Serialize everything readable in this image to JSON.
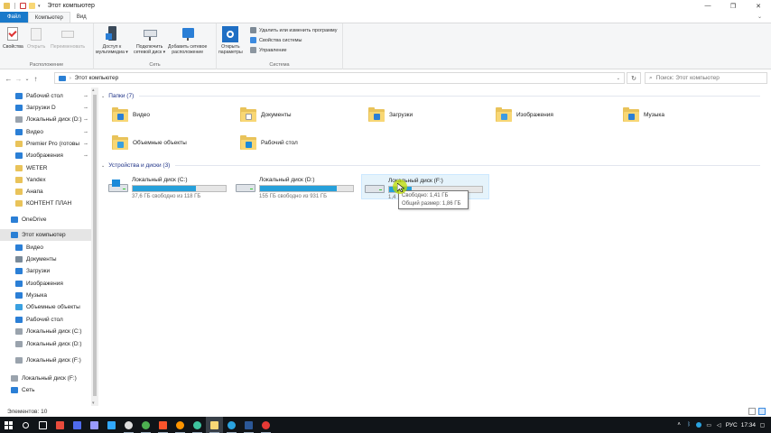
{
  "window": {
    "title": "Этот компьютер",
    "minimize": "—",
    "maximize": "❐",
    "close": "✕"
  },
  "ribbon_tabs": {
    "file": "Файл",
    "computer": "Компьютер",
    "view": "Вид",
    "collapse": "⌄"
  },
  "ribbon": {
    "groups": {
      "location": "Расположение",
      "network": "Сеть",
      "system": "Система"
    },
    "properties": "Свойства",
    "open": "Открыть",
    "rename": "Переименовать",
    "media_access_1": "Доступ к",
    "media_access_2": "мультимедиа ▾",
    "map_drive_1": "Подключить",
    "map_drive_2": "сетевой диск ▾",
    "add_location_1": "Добавить сетевое",
    "add_location_2": "расположение",
    "open_settings_1": "Открыть",
    "open_settings_2": "параметры",
    "uninstall": "Удалить или изменить программу",
    "system_props": "Свойства системы",
    "manage": "Управление"
  },
  "address": {
    "back": "←",
    "forward": "→",
    "recent": "⌄",
    "up": "↑",
    "path": "Этот компьютер",
    "dropdown": "⌄",
    "refresh": "↻",
    "search_placeholder": "Поиск: Этот компьютер",
    "search_icon": "⌕"
  },
  "nav": {
    "quick": [
      {
        "label": "Рабочий стол",
        "icon": "desktop-icon",
        "color": "#2b7fd6",
        "pinned": true
      },
      {
        "label": "Загрузки D",
        "icon": "download-icon",
        "color": "#2b7fd6",
        "pinned": true
      },
      {
        "label": "Локальный диск (D:)",
        "icon": "drive-icon",
        "color": "#9aa3ad",
        "pinned": true
      },
      {
        "label": "Видео",
        "icon": "video-icon",
        "color": "#2b7fd6",
        "pinned": true
      },
      {
        "label": "Premier Pro (готовы",
        "icon": "folder-icon",
        "color": "#e9c35a",
        "pinned": true
      },
      {
        "label": "Изображения",
        "icon": "pictures-icon",
        "color": "#2b7fd6",
        "pinned": true
      },
      {
        "label": "WETER",
        "icon": "folder-icon",
        "color": "#e9c35a",
        "pinned": false
      },
      {
        "label": "Yandex",
        "icon": "folder-icon",
        "color": "#e9c35a",
        "pinned": false
      },
      {
        "label": "Анапа",
        "icon": "folder-icon",
        "color": "#e9c35a",
        "pinned": false
      },
      {
        "label": "КОНТЕНТ ПЛАН",
        "icon": "folder-icon",
        "color": "#e9c35a",
        "pinned": false
      }
    ],
    "onedrive": "OneDrive",
    "this_pc": "Этот компьютер",
    "pc_items": [
      {
        "label": "Видео",
        "icon": "video-icon",
        "color": "#2b7fd6"
      },
      {
        "label": "Документы",
        "icon": "documents-icon",
        "color": "#7a8a99"
      },
      {
        "label": "Загрузки",
        "icon": "download-icon",
        "color": "#2b7fd6"
      },
      {
        "label": "Изображения",
        "icon": "pictures-icon",
        "color": "#2b7fd6"
      },
      {
        "label": "Музыка",
        "icon": "music-icon",
        "color": "#2b7fd6"
      },
      {
        "label": "Объемные объекты",
        "icon": "3d-objects-icon",
        "color": "#3aa0e0"
      },
      {
        "label": "Рабочий стол",
        "icon": "desktop-icon",
        "color": "#2b7fd6"
      },
      {
        "label": "Локальный диск (C:)",
        "icon": "drive-icon",
        "color": "#9aa3ad"
      },
      {
        "label": "Локальный диск (D:)",
        "icon": "drive-icon",
        "color": "#9aa3ad"
      },
      {
        "label": "Локальный диск (F:)",
        "icon": "drive-icon",
        "color": "#9aa3ad"
      }
    ],
    "usb_drive": "Локальный диск (F:)",
    "network": "Сеть",
    "pin_glyph": "📌",
    "pin_fallback": "⊸"
  },
  "folders_header": "Папки (7)",
  "folders": [
    {
      "label": "Видео",
      "icon": "video-folder-icon",
      "badge": "#2b7fd6"
    },
    {
      "label": "Документы",
      "icon": "documents-folder-icon",
      "badge": "#ffffff"
    },
    {
      "label": "Загрузки",
      "icon": "downloads-folder-icon",
      "badge": "#2b7fd6"
    },
    {
      "label": "Изображения",
      "icon": "pictures-folder-icon",
      "badge": "#3c9be4"
    },
    {
      "label": "Музыка",
      "icon": "music-folder-icon",
      "badge": "#2b7fd6"
    },
    {
      "label": "Объемные объекты",
      "icon": "3d-folder-icon",
      "badge": "#3aa0e0"
    },
    {
      "label": "Рабочий стол",
      "icon": "desktop-folder-icon",
      "badge": "#1b8ad9"
    }
  ],
  "drives_header": "Устройства и диски (3)",
  "drives": [
    {
      "label": "Локальный диск (C:)",
      "free": "37,6 ГБ свободно из 118 ГБ",
      "used_fraction": 0.68,
      "color": "#26a0da",
      "windows": true
    },
    {
      "label": "Локальный диск (D:)",
      "free": "155 ГБ свободно из 931 ГБ",
      "used_fraction": 0.83,
      "color": "#26a0da",
      "windows": false
    },
    {
      "label": "Локальный диск (F:)",
      "free": "1,4",
      "used_fraction": 0.24,
      "color": "#26a0da",
      "windows": false
    }
  ],
  "tooltip": {
    "free": "Свободно: 1,41 ГБ",
    "total": "Общий размер: 1,86 ГБ"
  },
  "status": "Элементов: 10",
  "taskbar": {
    "apps": [
      {
        "icon": "windows-start-icon",
        "color": "#ffffff"
      },
      {
        "icon": "search-icon",
        "color": "#ffffff"
      },
      {
        "icon": "task-view-icon",
        "color": "#ffffff"
      },
      {
        "icon": "store-icon",
        "color": "#e94b3c"
      },
      {
        "icon": "calculator-icon",
        "color": "#4f6bed"
      },
      {
        "icon": "premiere-icon",
        "color": "#9999ff"
      },
      {
        "icon": "photoshop-icon",
        "color": "#31a8ff"
      },
      {
        "icon": "yandex-browser-icon",
        "color": "#dddddd"
      },
      {
        "icon": "chrome-icon",
        "color": "#4caf50"
      },
      {
        "icon": "brave-icon",
        "color": "#fb542b"
      },
      {
        "icon": "firefox-icon",
        "color": "#ff9500"
      },
      {
        "icon": "app-icon",
        "color": "#3ec5a0"
      },
      {
        "icon": "file-explorer-icon",
        "color": "#f8d775"
      },
      {
        "icon": "telegram-icon",
        "color": "#2aa3e0"
      },
      {
        "icon": "word-icon",
        "color": "#2b5797"
      },
      {
        "icon": "recorder-icon",
        "color": "#e53935"
      }
    ],
    "lang": "РУС",
    "time": "17:34"
  },
  "colors": {
    "accent": "#1979ca",
    "folder": "#f8d775",
    "drive_bar": "#26a0da"
  }
}
